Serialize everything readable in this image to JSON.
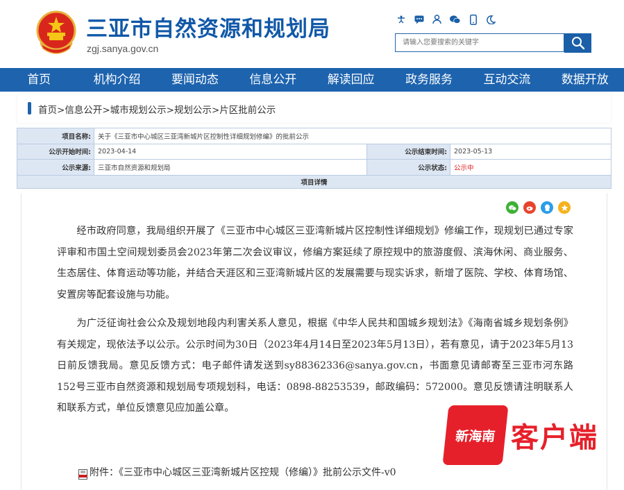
{
  "header": {
    "title": "三亚市自然资源和规划局",
    "domain": "zgj.sanya.gov.cn",
    "search_placeholder": "请输入您要搜索的关键字"
  },
  "top_icons": [
    "accessibility-icon",
    "message-icon",
    "user-icon",
    "wechat-icon",
    "mobile-icon",
    "night-mode-icon"
  ],
  "nav": {
    "items": [
      "首页",
      "机构介绍",
      "要闻动态",
      "信息公开",
      "解读回应",
      "政务服务",
      "互动交流",
      "数据开放"
    ]
  },
  "breadcrumb": {
    "items": [
      "首页",
      "信息公开",
      "城市规划公示",
      "规划公示",
      "片区批前公示"
    ],
    "separator": ">"
  },
  "info": {
    "project_name_label": "项目名称:",
    "project_name": "关于《三亚市中心城区三亚湾新城片区控制性详细规划修编》的批前公示",
    "start_label": "公示开始时间:",
    "start": "2023-04-14",
    "end_label": "公示结束时间:",
    "end": "2023-05-13",
    "source_label": "公示来源:",
    "source": "三亚市自然资源和规划局",
    "status_label": "公示状态:",
    "status": "公示中",
    "details_header": "项目详情"
  },
  "content": {
    "p1": "经市政府同意，我局组织开展了《三亚市中心城区三亚湾新城片区控制性详细规划》修编工作，现规划已通过专家评审和市国土空间规划委员会2023年第二次会议审议，修编方案延续了原控规中的旅游度假、滨海休闲、商业服务、生态居住、体育运动等功能，并结合天涯区和三亚湾新城片区的发展需要与现实诉求，新增了医院、学校、体育场馆、安置房等配套设施与功能。",
    "p2": "为广泛征询社会公众及规划地段内利害关系人意见，根据《中华人民共和国城乡规划法》《海南省城乡规划条例》有关规定，现依法予以公示。公示时间为30日（2023年4月14日至2023年5月13日），若有意见，请于2023年5月13日前反馈我局。意见反馈方式：电子邮件请发送到sy88362336@sanya.gov.cn，书面意见请邮寄至三亚市河东路152号三亚市自然资源和规划局专项规划科，电话：0898-88253539，邮政编码：572000。意见反馈请注明联系人和联系方式，单位反馈意见应加盖公章。",
    "attachment": "附件：《三亚市中心城区三亚湾新城片区控规（修编）》批前公示文件-v0"
  },
  "share_icons": [
    "wechat-share-icon",
    "weibo-share-icon",
    "qq-share-icon",
    "qzone-share-icon"
  ],
  "watermark": {
    "logo_text": "新海南",
    "text": "客户端"
  },
  "colors": {
    "brand_blue": "#1d63ae",
    "status_red": "#e02020",
    "watermark_red": "#e6202a"
  }
}
